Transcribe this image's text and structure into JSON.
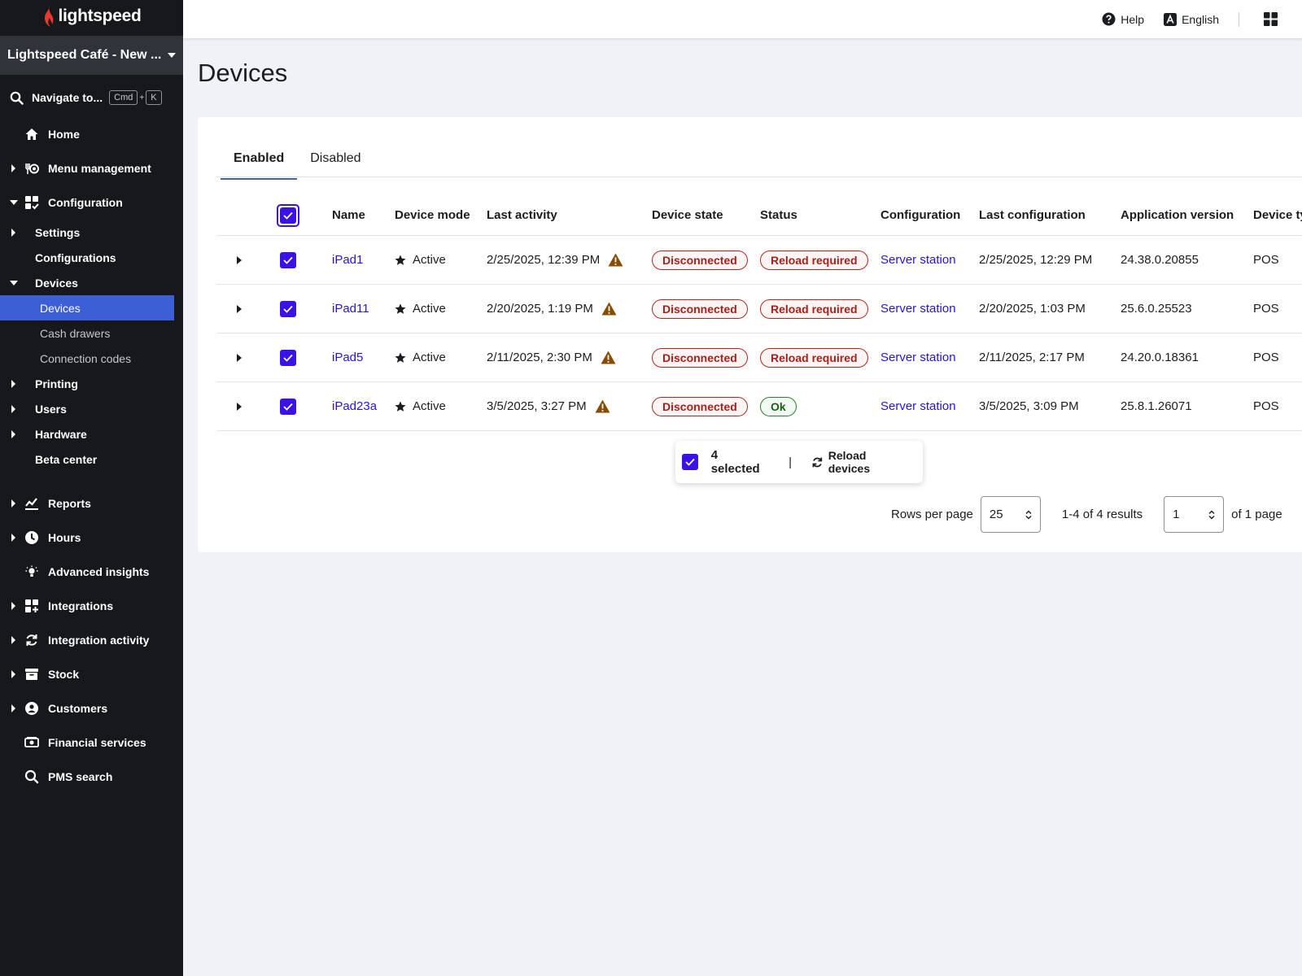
{
  "app": {
    "logo_text": "lightspeed",
    "location": "Lightspeed Café - New ...",
    "navigate": {
      "label": "Navigate to...",
      "key1": "Cmd",
      "plus": "+",
      "key2": "K"
    }
  },
  "sidebar": {
    "items": [
      {
        "label": "Home"
      },
      {
        "label": "Menu management"
      },
      {
        "label": "Configuration"
      },
      {
        "label": "Settings"
      },
      {
        "label": "Configurations"
      },
      {
        "label": "Devices"
      },
      {
        "label": "Devices"
      },
      {
        "label": "Cash drawers"
      },
      {
        "label": "Connection codes"
      },
      {
        "label": "Printing"
      },
      {
        "label": "Users"
      },
      {
        "label": "Hardware"
      },
      {
        "label": "Beta center"
      },
      {
        "label": "Reports"
      },
      {
        "label": "Hours"
      },
      {
        "label": "Advanced insights"
      },
      {
        "label": "Integrations"
      },
      {
        "label": "Integration activity"
      },
      {
        "label": "Stock"
      },
      {
        "label": "Customers"
      },
      {
        "label": "Financial services"
      },
      {
        "label": "PMS search"
      }
    ]
  },
  "topbar": {
    "help": "Help",
    "language": "English"
  },
  "page": {
    "title": "Devices"
  },
  "tabs": {
    "enabled": "Enabled",
    "disabled": "Disabled"
  },
  "table": {
    "headers": {
      "name": "Name",
      "mode": "Device mode",
      "activity": "Last activity",
      "state": "Device state",
      "status": "Status",
      "configuration": "Configuration",
      "last_configuration": "Last configuration",
      "version": "Application version",
      "type": "Device ty"
    },
    "rows": [
      {
        "name": "iPad1",
        "mode": "Active",
        "activity": "2/25/2025, 12:39 PM",
        "state": "Disconnected",
        "status": "Reload required",
        "configuration": "Server station",
        "last_configuration": "2/25/2025, 12:29 PM",
        "version": "24.38.0.20855",
        "type": "POS"
      },
      {
        "name": "iPad11",
        "mode": "Active",
        "activity": "2/20/2025, 1:19 PM",
        "state": "Disconnected",
        "status": "Reload required",
        "configuration": "Server station",
        "last_configuration": "2/20/2025, 1:03 PM",
        "version": "25.6.0.25523",
        "type": "POS"
      },
      {
        "name": "iPad5",
        "mode": "Active",
        "activity": "2/11/2025, 2:30 PM",
        "state": "Disconnected",
        "status": "Reload required",
        "configuration": "Server station",
        "last_configuration": "2/11/2025, 2:17 PM",
        "version": "24.20.0.18361",
        "type": "POS"
      },
      {
        "name": "iPad23a",
        "mode": "Active",
        "activity": "3/5/2025, 3:27 PM",
        "state": "Disconnected",
        "status": "Ok",
        "configuration": "Server station",
        "last_configuration": "3/5/2025, 3:09 PM",
        "version": "25.8.1.26071",
        "type": "POS"
      }
    ]
  },
  "selection": {
    "count": "4 selected",
    "separator": "|",
    "reload": "Reload devices"
  },
  "pagination": {
    "rows_label": "Rows per page",
    "rows_value": "25",
    "results": "1-4 of 4 results",
    "page_value": "1",
    "of_pages": "of 1 page"
  },
  "colors": {
    "sidebar_bg": "#16181c",
    "accent": "#3a12e8",
    "active_nav": "#3d5fd6",
    "link": "#2614d6",
    "error": "#b3261e",
    "ok": "#2e7d32",
    "warning": "#8a4b00"
  }
}
